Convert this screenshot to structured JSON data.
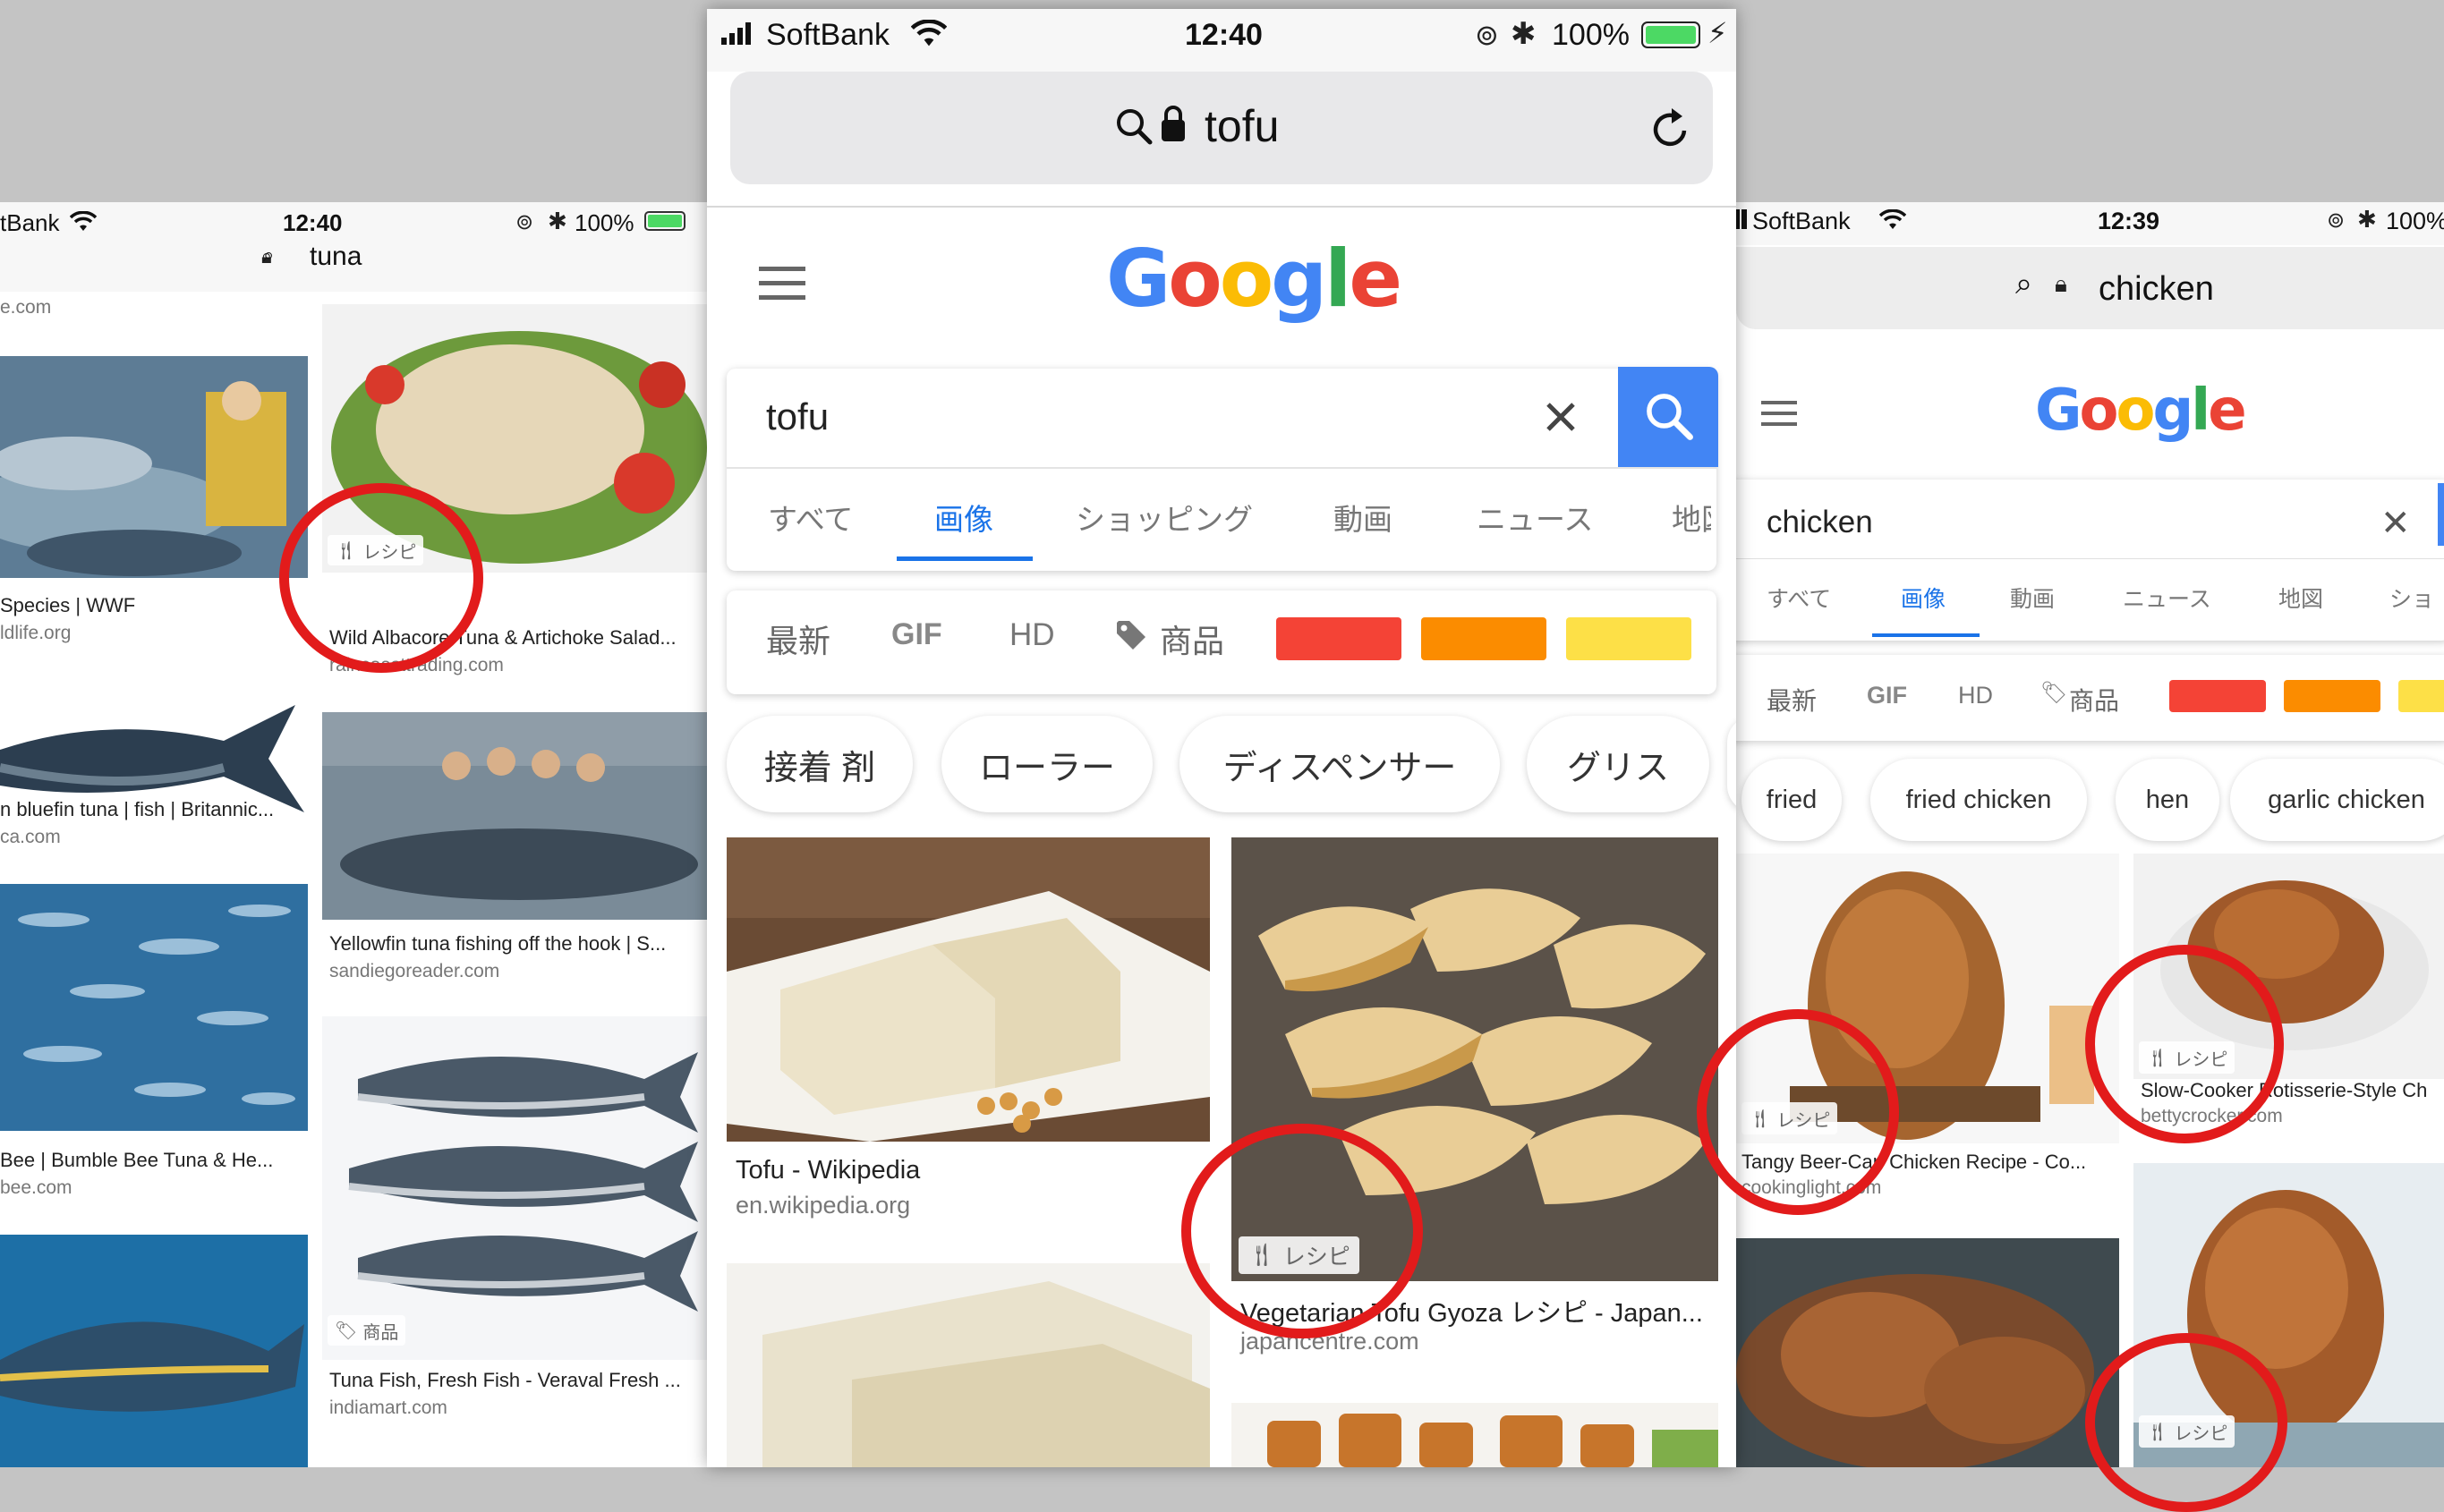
{
  "left": {
    "status": {
      "carrier": "tBank",
      "time": "12:40",
      "battery": "100%"
    },
    "url": "tuna",
    "col1": [
      {
        "title": "Species | WWF",
        "source": "ldlife.org"
      },
      {
        "title": "n bluefin tuna | fish | Britannic...",
        "source": "ca.com"
      },
      {
        "title": "Bee | Bumble Bee Tuna & He...",
        "source": "bee.com"
      }
    ],
    "col1_top_source": "e.com",
    "col2": [
      {
        "title": "Wild Albacore Tuna & Artichoke Salad...",
        "source": "raincoasttrading.com",
        "badge": "レシピ"
      },
      {
        "title": "Yellowfin tuna fishing off the hook | S...",
        "source": "sandiegoreader.com"
      },
      {
        "title": "Tuna Fish, Fresh Fish - Veraval Fresh ...",
        "source": "indiamart.com",
        "badge": "商品"
      }
    ]
  },
  "center": {
    "status": {
      "carrier": "SoftBank",
      "time": "12:40",
      "battery": "100%"
    },
    "url": "tofu",
    "logo": "Google",
    "search": {
      "query": "tofu"
    },
    "tabs": [
      "すべて",
      "画像",
      "ショッピング",
      "動画",
      "ニュース",
      "地図"
    ],
    "active_tab": "画像",
    "filters": {
      "latest": "最新",
      "gif": "GIF",
      "hd": "HD",
      "product": "商品"
    },
    "swatches": [
      "#f44336",
      "#fb8c00",
      "#fde047"
    ],
    "chips": [
      "接着 剤",
      "ローラー",
      "ディスペンサー",
      "グリス"
    ],
    "results": [
      {
        "title": "Tofu - Wikipedia",
        "source": "en.wikipedia.org"
      },
      {
        "title": "Vegetarian Tofu Gyoza レシピ - Japan...",
        "source": "japancentre.com",
        "badge": "レシピ"
      }
    ]
  },
  "right": {
    "status": {
      "carrier": "SoftBank",
      "time": "12:39",
      "battery": "100%"
    },
    "url": "chicken",
    "logo": "Google",
    "search": {
      "query": "chicken"
    },
    "tabs": [
      "すべて",
      "画像",
      "動画",
      "ニュース",
      "地図",
      "ショ"
    ],
    "active_tab": "画像",
    "filters": {
      "latest": "最新",
      "gif": "GIF",
      "hd": "HD",
      "product": "商品"
    },
    "chips": [
      "fried",
      "fried chicken",
      "hen",
      "garlic chicken"
    ],
    "results": [
      {
        "title": "Tangy Beer-Can Chicken Recipe - Co...",
        "source": "cookinglight.com",
        "badge": "レシピ"
      },
      {
        "title": "Slow-Cooker Rotisserie-Style Ch",
        "source": "bettycrocker.com",
        "badge": "レシピ"
      },
      {
        "badge": "レシピ"
      }
    ]
  },
  "colors": {
    "google_blue": "#4285f4",
    "google_red": "#ea4335",
    "google_yellow": "#fbbc05",
    "google_green": "#34a853",
    "annotation_red": "#e21b1b",
    "tab_blue": "#1a73e8"
  }
}
